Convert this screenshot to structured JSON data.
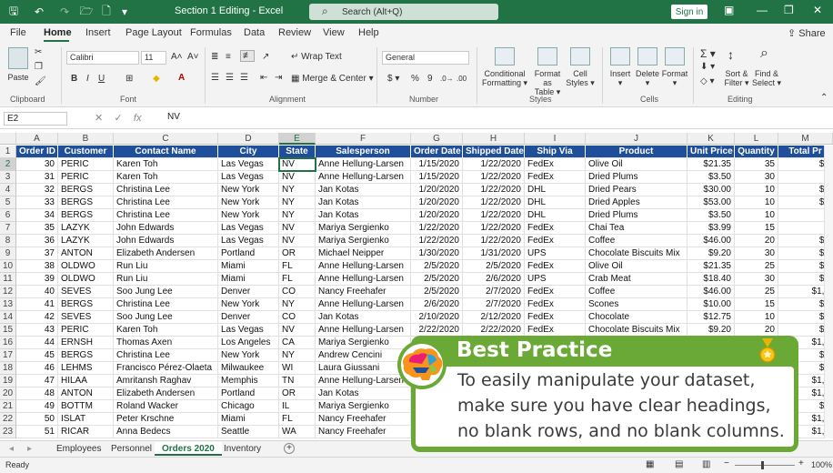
{
  "titlebar": {
    "title": "Section 1 Editing  -  Excel",
    "search_placeholder": "Search (Alt+Q)",
    "signin_label": "Sign in"
  },
  "menu": {
    "items": [
      "File",
      "Home",
      "Insert",
      "Page Layout",
      "Formulas",
      "Data",
      "Review",
      "View",
      "Help"
    ],
    "active": "Home",
    "share_label": "Share"
  },
  "ribbon": {
    "clipboard": {
      "paste_label": "Paste",
      "group_label": "Clipboard"
    },
    "font": {
      "font_name": "Calibri",
      "font_size": "11",
      "group_label": "Font"
    },
    "alignment": {
      "wrap_text": "Wrap Text",
      "merge_center": "Merge & Center",
      "group_label": "Alignment"
    },
    "number": {
      "format": "General",
      "group_label": "Number"
    },
    "styles": {
      "conditional": "Conditional",
      "formatting": "Formatting",
      "format_as": "Format as",
      "table": "Table",
      "cell": "Cell",
      "cell_styles": "Styles",
      "group_label": "Styles"
    },
    "cells": {
      "insert": "Insert",
      "delete": "Delete",
      "format": "Format",
      "group_label": "Cells"
    },
    "editing": {
      "sort": "Sort &",
      "filter": "Filter",
      "find": "Find &",
      "select": "Select",
      "group_label": "Editing"
    }
  },
  "formula_bar": {
    "name_box": "E2",
    "value": "NV"
  },
  "columns": [
    "A",
    "B",
    "C",
    "D",
    "E",
    "F",
    "G",
    "H",
    "I",
    "J",
    "K",
    "L",
    "M"
  ],
  "header_row": [
    "Order ID",
    "Customer",
    "Contact Name",
    "City",
    "State",
    "Salesperson",
    "Order Date",
    "Shipped Date",
    "Ship Via",
    "Product",
    "Unit Price",
    "Quantity",
    "Total Pr"
  ],
  "rows": [
    [
      "30",
      "PERIC",
      "Karen Toh",
      "Las Vegas",
      "NV",
      "Anne Hellung-Larsen",
      "1/15/2020",
      "1/22/2020",
      "FedEx",
      "Olive Oil",
      "$21.35",
      "35",
      "$7"
    ],
    [
      "31",
      "PERIC",
      "Karen Toh",
      "Las Vegas",
      "NV",
      "Anne Hellung-Larsen",
      "1/15/2020",
      "1/22/2020",
      "FedEx",
      "Dried Plums",
      "$3.50",
      "30",
      "$"
    ],
    [
      "32",
      "BERGS",
      "Christina Lee",
      "New York",
      "NY",
      "Jan Kotas",
      "1/20/2020",
      "1/22/2020",
      "DHL",
      "Dried Pears",
      "$30.00",
      "10",
      "$3"
    ],
    [
      "33",
      "BERGS",
      "Christina Lee",
      "New York",
      "NY",
      "Jan Kotas",
      "1/20/2020",
      "1/22/2020",
      "DHL",
      "Dried Apples",
      "$53.00",
      "10",
      "$5"
    ],
    [
      "34",
      "BERGS",
      "Christina Lee",
      "New York",
      "NY",
      "Jan Kotas",
      "1/20/2020",
      "1/22/2020",
      "DHL",
      "Dried Plums",
      "$3.50",
      "10",
      "$"
    ],
    [
      "35",
      "LAZYK",
      "John Edwards",
      "Las Vegas",
      "NV",
      "Mariya Sergienko",
      "1/22/2020",
      "1/22/2020",
      "FedEx",
      "Chai Tea",
      "$3.99",
      "15",
      "$"
    ],
    [
      "36",
      "LAZYK",
      "John Edwards",
      "Las Vegas",
      "NV",
      "Mariya Sergienko",
      "1/22/2020",
      "1/22/2020",
      "FedEx",
      "Coffee",
      "$46.00",
      "20",
      "$9"
    ],
    [
      "37",
      "ANTON",
      "Elizabeth Andersen",
      "Portland",
      "OR",
      "Michael Neipper",
      "1/30/2020",
      "1/31/2020",
      "UPS",
      "Chocolate Biscuits Mix",
      "$9.20",
      "30",
      "$2"
    ],
    [
      "38",
      "OLDWO",
      "Run Liu",
      "Miami",
      "FL",
      "Anne Hellung-Larsen",
      "2/5/2020",
      "2/5/2020",
      "FedEx",
      "Olive Oil",
      "$21.35",
      "25",
      "$5"
    ],
    [
      "39",
      "OLDWO",
      "Run Liu",
      "Miami",
      "FL",
      "Anne Hellung-Larsen",
      "2/5/2020",
      "2/6/2020",
      "UPS",
      "Crab Meat",
      "$18.40",
      "30",
      "$5"
    ],
    [
      "40",
      "SEVES",
      "Soo Jung Lee",
      "Denver",
      "CO",
      "Nancy Freehafer",
      "2/5/2020",
      "2/7/2020",
      "FedEx",
      "Coffee",
      "$46.00",
      "25",
      "$1,1"
    ],
    [
      "41",
      "BERGS",
      "Christina Lee",
      "New York",
      "NY",
      "Anne Hellung-Larsen",
      "2/6/2020",
      "2/7/2020",
      "FedEx",
      "Scones",
      "$10.00",
      "15",
      "$1"
    ],
    [
      "42",
      "SEVES",
      "Soo Jung Lee",
      "Denver",
      "CO",
      "Jan Kotas",
      "2/10/2020",
      "2/12/2020",
      "FedEx",
      "Chocolate",
      "$12.75",
      "10",
      "$1"
    ],
    [
      "43",
      "PERIC",
      "Karen Toh",
      "Las Vegas",
      "NV",
      "Anne Hellung-Larsen",
      "2/22/2020",
      "2/22/2020",
      "FedEx",
      "Chocolate Biscuits Mix",
      "$9.20",
      "20",
      "$1"
    ],
    [
      "44",
      "ERNSH",
      "Thomas Axen",
      "Los Angeles",
      "CA",
      "Mariya Sergienko",
      "",
      "",
      "",
      "",
      "",
      "",
      "$1,9"
    ],
    [
      "45",
      "BERGS",
      "Christina Lee",
      "New York",
      "NY",
      "Andrew Cencini",
      "",
      "",
      "",
      "",
      "",
      "",
      "$1"
    ],
    [
      "46",
      "LEHMS",
      "Francisco Pérez-Olaeta",
      "Milwaukee",
      "WI",
      "Laura Giussani",
      "",
      "",
      "",
      "",
      "",
      "",
      "$6"
    ],
    [
      "47",
      "HILAA",
      "Amritansh Raghav",
      "Memphis",
      "TN",
      "Anne Hellung-Larsen",
      "",
      "",
      "",
      "",
      "",
      "",
      "$1,2"
    ],
    [
      "48",
      "ANTON",
      "Elizabeth Andersen",
      "Portland",
      "OR",
      "Jan Kotas",
      "",
      "",
      "",
      "",
      "",
      "",
      "$1,2"
    ],
    [
      "49",
      "BOTTM",
      "Roland Wacker",
      "Chicago",
      "IL",
      "Mariya Sergienko",
      "",
      "",
      "",
      "",
      "",
      "",
      "$6"
    ],
    [
      "50",
      "ISLAT",
      "Peter Krschne",
      "Miami",
      "FL",
      "Nancy Freehafer",
      "",
      "",
      "",
      "",
      "",
      "",
      "$1,9"
    ],
    [
      "51",
      "RICAR",
      "Anna Bedecs",
      "Seattle",
      "WA",
      "Nancy Freehafer",
      "",
      "",
      "",
      "",
      "",
      "",
      "$1,9"
    ]
  ],
  "sheets": {
    "tabs": [
      "Employees",
      "Personnel",
      "Orders 2020",
      "Inventory"
    ],
    "active": "Orders 2020"
  },
  "status": {
    "ready": "Ready",
    "zoom": "100%"
  },
  "callout": {
    "title": "Best Practice",
    "lines": [
      "To easily manipulate your dataset,",
      "make sure you have clear headings,",
      "no blank rows, and no blank columns."
    ]
  }
}
